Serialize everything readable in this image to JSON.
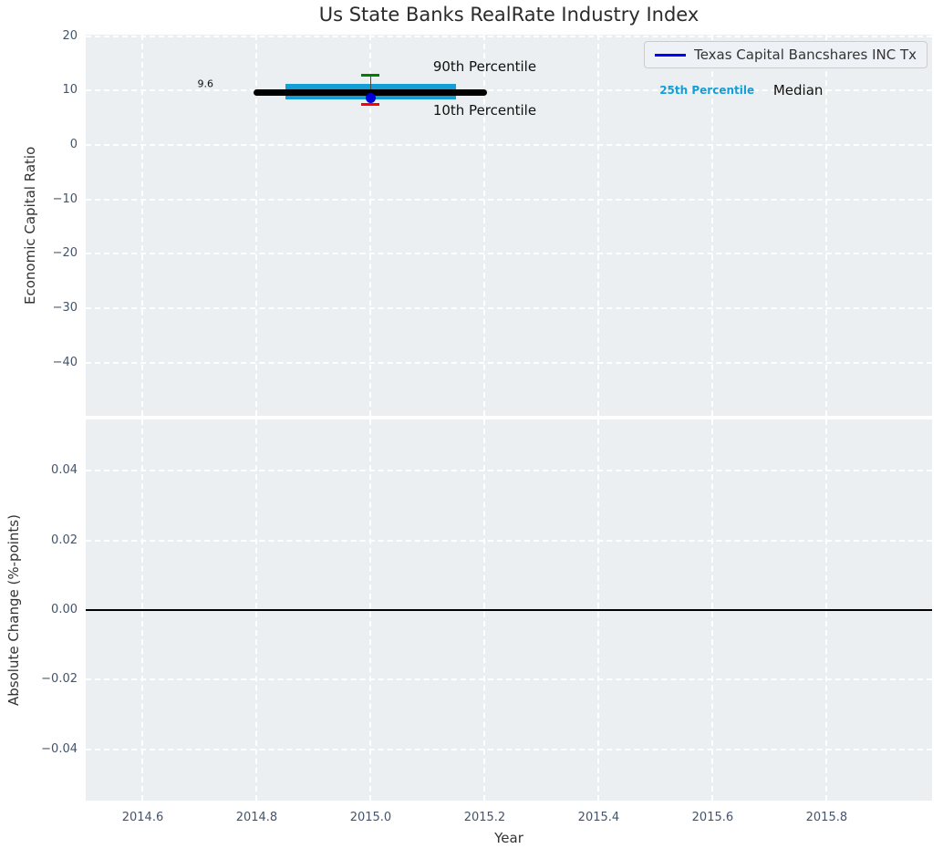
{
  "figure": {
    "title": "Us State Banks RealRate Industry Index",
    "background": "#ffffff",
    "axes_background": "#ebeff1",
    "grid_color": "#ffffff",
    "tick_color": "#44546a"
  },
  "legend": {
    "label": "Texas Capital Bancshares INC Tx",
    "line_color": "#0000ff",
    "position": "upper right"
  },
  "chart_data": [
    {
      "type": "box-percentile",
      "title": "Us State Banks RealRate Industry Index",
      "xlabel": "",
      "ylabel": "Economic Capital Ratio",
      "xlim": [
        2014.5,
        2015.985
      ],
      "ylim": [
        -49.8,
        20.3
      ],
      "grid": true,
      "yticks": [
        20,
        10,
        0,
        -10,
        -20,
        -30,
        -40
      ],
      "ytick_labels": [
        "20",
        "10",
        "0",
        "−10",
        "−20",
        "−30",
        "−40"
      ],
      "xticks": [
        2014.6,
        2014.8,
        2015.0,
        2015.2,
        2015.4,
        2015.6,
        2015.8
      ],
      "xtick_labels": [
        "2014.6",
        "2014.8",
        "2015.0",
        "2015.2",
        "2015.4",
        "2015.6",
        "2015.8"
      ],
      "show_xtick_labels": false,
      "median_line": {
        "x_start": 2014.8,
        "x_end": 2015.2,
        "value": 9.6,
        "color": "#000000"
      },
      "iqr_band": {
        "x_start": 2014.85,
        "x_end": 2015.15,
        "p25": 8.4,
        "p75": 11.2,
        "color": "#149ed6"
      },
      "whisker": {
        "x": 2015.0,
        "p10": 7.4,
        "p90": 12.8,
        "p90_color": "#008000",
        "p10_color": "#ff0000",
        "line_color": "#4a4a4a"
      },
      "company_point": {
        "x": 2015.0,
        "value": 8.6,
        "color": "#0000d8",
        "series": "Texas Capital Bancshares INC Tx"
      },
      "annotations": [
        {
          "text": "9.6",
          "x": 2014.71,
          "y": 11.3,
          "color": "#111111",
          "size": 11,
          "weight": "normal"
        },
        {
          "text": "90th Percentile",
          "x": 2015.2,
          "y": 14.4,
          "color": "#111111",
          "size": 15,
          "weight": "normal"
        },
        {
          "text": "10th Percentile",
          "x": 2015.2,
          "y": 6.4,
          "color": "#111111",
          "size": 15,
          "weight": "normal"
        },
        {
          "text": "25th Percentile",
          "x": 2015.59,
          "y": 10.0,
          "color": "#149ed6",
          "size": 12,
          "weight": "bold"
        },
        {
          "text": "Median",
          "x": 2015.75,
          "y": 10.0,
          "color": "#111111",
          "size": 15,
          "weight": "normal"
        }
      ],
      "legend_entries": [
        {
          "label": "Texas Capital Bancshares INC Tx",
          "color": "#0000ff"
        }
      ]
    },
    {
      "type": "line",
      "title": "",
      "xlabel": "Year",
      "ylabel": "Absolute Change (%-points)",
      "xlim": [
        2014.5,
        2015.985
      ],
      "ylim": [
        -0.0547,
        0.0547
      ],
      "grid": true,
      "yticks": [
        0.04,
        0.02,
        0.0,
        -0.02,
        -0.04
      ],
      "ytick_labels": [
        "0.04",
        "0.02",
        "0.00",
        "−0.02",
        "−0.04"
      ],
      "xticks": [
        2014.6,
        2014.8,
        2015.0,
        2015.2,
        2015.4,
        2015.6,
        2015.8
      ],
      "xtick_labels": [
        "2014.6",
        "2014.8",
        "2015.0",
        "2015.2",
        "2015.4",
        "2015.6",
        "2015.8"
      ],
      "show_xtick_labels": true,
      "zero_line": {
        "y": 0.0,
        "color": "#000000"
      },
      "series": []
    }
  ]
}
